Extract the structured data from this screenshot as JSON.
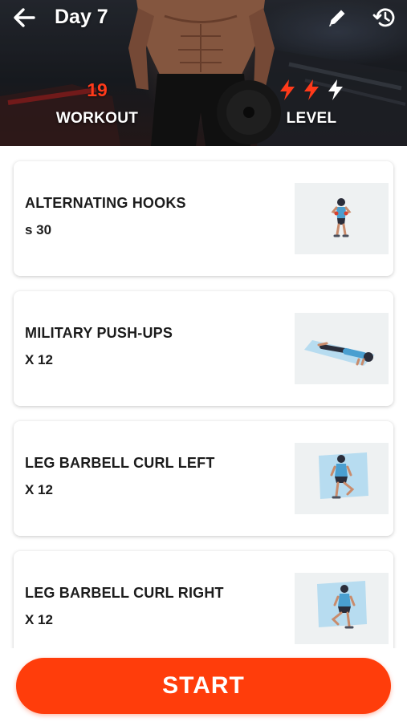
{
  "header": {
    "title": "Day 7",
    "back_icon": "arrow-left-icon",
    "edit_icon": "pencil-icon",
    "history_icon": "history-icon"
  },
  "stats": {
    "workout_value": "19",
    "workout_label": "WORKOUT",
    "level_label": "LEVEL",
    "level_value": 2,
    "level_max": 3
  },
  "exercises": [
    {
      "name": "ALTERNATING HOOKS",
      "reps": "s 30"
    },
    {
      "name": "MILITARY PUSH-UPS",
      "reps": "X 12"
    },
    {
      "name": "LEG BARBELL CURL LEFT",
      "reps": "X 12"
    },
    {
      "name": "LEG BARBELL CURL RIGHT",
      "reps": "X 12"
    }
  ],
  "start_label": "START",
  "colors": {
    "accent": "#ff3d0b",
    "stat_highlight": "#ff3a1a",
    "thumb_bg": "#eef1f2"
  }
}
